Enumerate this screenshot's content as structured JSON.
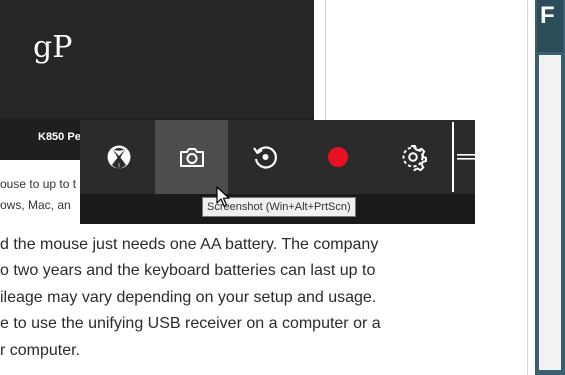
{
  "product_image": {
    "logo": "gP",
    "caption": "K850 Pe"
  },
  "caption_fragments": [
    "ouse to up to t",
    "ows, Mac, an"
  ],
  "article_lines": [
    "d the mouse just needs one AA battery. The company",
    "o two years and the keyboard batteries can last up to",
    "ileage may vary depending on your setup and usage.",
    "e to use the unifying USB receiver on a computer or a",
    "r computer."
  ],
  "game_bar": {
    "buttons": [
      {
        "name": "xbox",
        "icon": "xbox-icon"
      },
      {
        "name": "screenshot",
        "icon": "camera-icon",
        "active": true
      },
      {
        "name": "record-last",
        "icon": "record-last-icon"
      },
      {
        "name": "record",
        "icon": "record-icon"
      },
      {
        "name": "settings",
        "icon": "gear-icon"
      }
    ],
    "record_color": "#e81123",
    "grip_icon": "grip-icon"
  },
  "tooltip": {
    "text": "Screenshot (Win+Alt+PrtScn)"
  },
  "colors": {
    "bar_background": "#2b2b2b",
    "bar_active": "#4d4d4d",
    "strip": "#3a5f6e"
  }
}
